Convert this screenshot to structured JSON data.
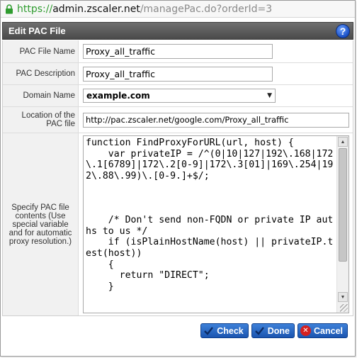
{
  "browser": {
    "url_scheme": "https://",
    "url_host": "admin.zscaler.net",
    "url_path": "/managePac.do?orderId=3"
  },
  "dialog": {
    "title": "Edit PAC File",
    "help_symbol": "?"
  },
  "form": {
    "file_name_label": "PAC File Name",
    "file_name_value": "Proxy_all_traffic",
    "description_label": "PAC Description",
    "description_value": "Proxy_all_traffic",
    "domain_label": "Domain Name",
    "domain_value": "example.com",
    "location_label": "Location of the PAC file",
    "location_value": "http://pac.zscaler.net/google.com/Proxy_all_traffic",
    "contents_label": "Specify PAC file contents (Use special variable and for automatic proxy resolution.)",
    "contents_value": "function FindProxyForURL(url, host) {\n    var privateIP = /^(0|10|127|192\\.168|172\\.1[6789]|172\\.2[0-9]|172\\.3[01]|169\\.254|192\\.88\\.99)\\.[0-9.]+$/;\n\n\n\n    /* Don't send non-FQDN or private IP auths to us */\n    if (isPlainHostName(host) || privateIP.test(host))\n    {\n      return \"DIRECT\";\n    }"
  },
  "buttons": {
    "check": "Check",
    "done": "Done",
    "cancel": "Cancel"
  },
  "colors": {
    "header": "#4a4a4a",
    "button": "#1b55b0",
    "url_secure": "#2f9c2f"
  }
}
